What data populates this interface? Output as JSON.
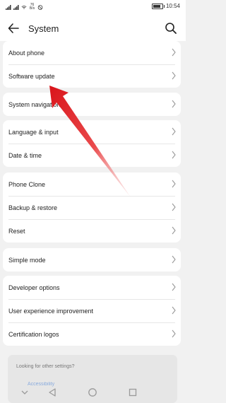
{
  "status_bar": {
    "left_glyphs": "36 4G",
    "speed_top": "76",
    "speed_bottom": "B/s",
    "time": "10:54",
    "battery_level": 0.8
  },
  "header": {
    "title": "System",
    "back_icon": "back-arrow-icon",
    "search_icon": "search-icon"
  },
  "groups": [
    {
      "items": [
        {
          "label": "About phone"
        },
        {
          "label": "Software update"
        }
      ]
    },
    {
      "items": [
        {
          "label": "System navigation"
        }
      ]
    },
    {
      "items": [
        {
          "label": "Language & input"
        },
        {
          "label": "Date & time"
        }
      ]
    },
    {
      "items": [
        {
          "label": "Phone Clone"
        },
        {
          "label": "Backup & restore"
        },
        {
          "label": "Reset"
        }
      ]
    },
    {
      "items": [
        {
          "label": "Simple mode"
        }
      ]
    },
    {
      "items": [
        {
          "label": "Developer options"
        },
        {
          "label": "User experience improvement"
        },
        {
          "label": "Certification logos"
        }
      ]
    }
  ],
  "suggestion": {
    "question": "Looking for other settings?",
    "link": "Accessibility"
  },
  "colors": {
    "accent_arrow": "#e01b1b",
    "link": "#3c7ad6"
  }
}
